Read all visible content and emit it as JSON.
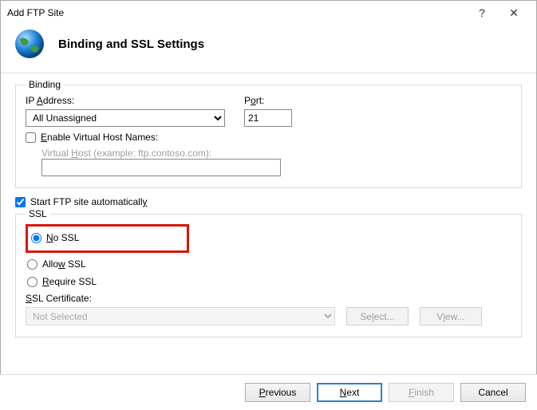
{
  "window": {
    "title": "Add FTP Site",
    "help": "?",
    "close": "✕"
  },
  "header": {
    "page_title": "Binding and SSL Settings"
  },
  "binding": {
    "legend": "Binding",
    "ip_label": "IP Address:",
    "ip_value": "All Unassigned",
    "port_label": "Port:",
    "port_value": "21",
    "enable_vh_label": "Enable Virtual Host Names:",
    "enable_vh_checked": false,
    "vh_label": "Virtual Host (example: ftp.contoso.com):",
    "vh_value": ""
  },
  "auto_start": {
    "label": "Start FTP site automatically",
    "checked": true
  },
  "ssl": {
    "legend": "SSL",
    "options": {
      "no_ssl": "No SSL",
      "allow_ssl": "Allow SSL",
      "require_ssl": "Require SSL"
    },
    "selected": "no_ssl",
    "cert_label": "SSL Certificate:",
    "cert_value": "Not Selected",
    "select_btn": "Select...",
    "view_btn": "View..."
  },
  "footer": {
    "previous": "Previous",
    "next": "Next",
    "finish": "Finish",
    "cancel": "Cancel"
  }
}
